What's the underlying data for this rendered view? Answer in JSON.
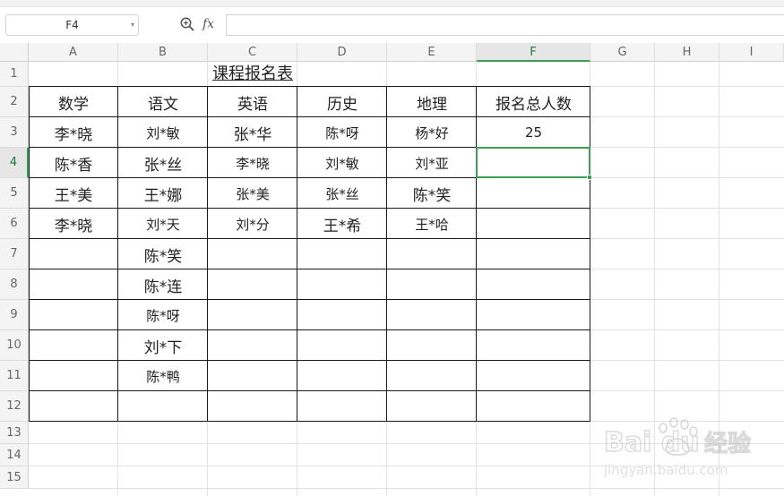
{
  "formula_bar": {
    "name_box": "F4",
    "fx_label": "fx",
    "formula_value": ""
  },
  "columns": [
    "A",
    "B",
    "C",
    "D",
    "E",
    "F",
    "G",
    "H",
    "I"
  ],
  "rows": [
    "1",
    "2",
    "3",
    "4",
    "5",
    "6",
    "7",
    "8",
    "9",
    "10",
    "11",
    "12",
    "13",
    "14",
    "15"
  ],
  "selected": {
    "column": "F",
    "row": "4"
  },
  "sheet": {
    "title": "课程报名表",
    "headers": [
      "数学",
      "语文",
      "英语",
      "历史",
      "地理",
      "报名总人数"
    ],
    "data_rows": [
      [
        "李*晓",
        "刘*敏",
        "张*华",
        "陈*呀",
        "杨*好",
        "25"
      ],
      [
        "陈*香",
        "张*丝",
        "李*晓",
        "刘*敏",
        "刘*亚",
        ""
      ],
      [
        "王*美",
        "王*娜",
        "张*美",
        "张*丝",
        "陈*笑",
        ""
      ],
      [
        "李*晓",
        "刘*天",
        "刘*分",
        "王*希",
        "王*哈",
        ""
      ],
      [
        "",
        "陈*笑",
        "",
        "",
        "",
        ""
      ],
      [
        "",
        "陈*连",
        "",
        "",
        "",
        ""
      ],
      [
        "",
        "陈*呀",
        "",
        "",
        "",
        ""
      ],
      [
        "",
        "刘*下",
        "",
        "",
        "",
        ""
      ],
      [
        "",
        "陈*鸭",
        "",
        "",
        "",
        ""
      ],
      [
        "",
        "",
        "",
        "",
        "",
        ""
      ]
    ]
  },
  "watermark": {
    "brand": "Bai du",
    "brand_cn": "经验",
    "url": "jingyan.baidu.com"
  },
  "colors": {
    "accent": "#3c9f55",
    "header_bg": "#f4f4f4",
    "grid": "#e2e2e2"
  }
}
